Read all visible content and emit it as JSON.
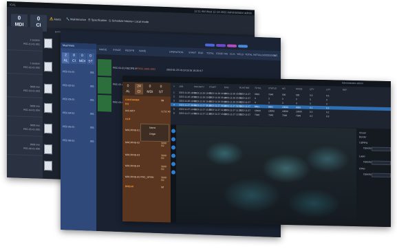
{
  "w1": {
    "title": "ICA1",
    "titlebar_right": "12:11 AM  Wed 12-14-2022   Administrator   admin",
    "tiles": [
      {
        "number": "0",
        "label": "MDI"
      },
      {
        "number": "0",
        "label": "CI"
      }
    ],
    "toolbar": [
      {
        "icon": "warning-icon",
        "label": "Alerts"
      },
      {
        "icon": "wrench-icon",
        "label": "Maintenance"
      },
      {
        "icon": "list-icon",
        "label": "Specification"
      },
      {
        "icon": "clock-icon",
        "label": "Schedule history"
      },
      {
        "icon": "add-user-icon",
        "label": "Local mode"
      }
    ],
    "sidebar": [
      {
        "a": "1 session",
        "b": "PEC-01-01 001"
      },
      {
        "a": "1 session",
        "b": "PEC-02-01 002"
      },
      {
        "a": "3000 min",
        "b": "PEC-03-01 003"
      },
      {
        "a": "3000 min",
        "b": "PEC-04-01 004"
      },
      {
        "a": "3000 min",
        "b": "PEC-05-01 005"
      },
      {
        "a": "3000 min",
        "b": "PEC-06-01 006"
      }
    ],
    "header_cols": [
      "BATCH",
      "BASEBATCH",
      "STATUS"
    ]
  },
  "w2": {
    "panel_title": "Machines",
    "minis": [
      {
        "n": "2",
        "l": "AL"
      },
      {
        "n": "8",
        "l": "CI"
      },
      {
        "n": "0",
        "l": "MDI"
      },
      {
        "n": "0",
        "l": "ST"
      }
    ],
    "left_items": [
      {
        "k": "PEC-01-01",
        "v": "001"
      },
      {
        "k": "PEC-02-01",
        "v": "001"
      },
      {
        "k": "PEC-03-01",
        "v": "001"
      },
      {
        "k": "PEC-04-01",
        "v": "001"
      },
      {
        "k": "PEC-05-01",
        "v": "001"
      },
      {
        "k": "PEC-06-01",
        "v": "001"
      }
    ],
    "headers": [
      "IMAGE",
      "STAGE",
      "RECIPE",
      "NAME",
      "OPERATION",
      "START",
      "END",
      "TOTAL",
      "GOOD",
      "NG",
      "CL%",
      "YIELD",
      "TOTAL",
      "INITIAL",
      "GOOD",
      "GOOD",
      "NG",
      "NG"
    ],
    "rows": [
      {
        "stage": "PEC-01-01 RECIPE A",
        "name": "PROC-1000-1002",
        "op": "2023-01-23 16:18 19:16 19:20 6:7"
      },
      {
        "stage": "PEC-02-01 RECIPE A",
        "name": "",
        "op": ""
      },
      {
        "stage": "PEC-03-01",
        "name": "",
        "op": ""
      }
    ]
  },
  "w3": {
    "titlebar": "Administrator   admin",
    "tiles": [
      {
        "n": "0",
        "l": "AL"
      },
      {
        "n": "24",
        "l": "CI"
      },
      {
        "n": "0",
        "l": "MDI"
      },
      {
        "n": "0",
        "l": "ST"
      }
    ],
    "rows": [
      {
        "k": "CONTAINER",
        "v": "16",
        "orange": true
      },
      {
        "k": "EQ",
        "v": "",
        "orange": true
      },
      {
        "k": "INS-MST",
        "v": "12:52:40",
        "orange": false
      },
      {
        "k": "OLD",
        "v": "",
        "orange": true
      },
      {
        "k": "MACHINE-01",
        "v": "3000 FR",
        "orange": false
      },
      {
        "k": "MACHINE-02",
        "v": "3000 FR",
        "orange": false
      },
      {
        "k": "MACHINE-03",
        "v": "3000 FR",
        "orange": false
      },
      {
        "k": "MACHINE-04",
        "v": "3000 FR",
        "orange": false
      },
      {
        "k": "MACHINE-05 PRC_OPEN",
        "v": "3000 FR",
        "orange": false
      },
      {
        "k": "BREAK",
        "v": "12",
        "orange": true
      }
    ],
    "popup": [
      "Name",
      "Origin"
    ],
    "columns": [
      "#",
      "JOB",
      "PRIORITY",
      "START",
      "END",
      "RUNTIME",
      "TOTAL",
      "STATUS",
      "NG",
      "MODE",
      "QTY",
      "LOT",
      "REF"
    ],
    "table": [
      [
        "1",
        "2023-11-26 18:00",
        "2023-11-26 19:00",
        "2023-11-26 19:30",
        "2023-11-26 20:00",
        "2023-11-27",
        "9999",
        "7048",
        "500",
        "500",
        "0.3",
        "0.5"
      ],
      [
        "2",
        "2023-11-26 18:50",
        "2023-11-26 19:50",
        "2023-11-26 20:10",
        "2023-11-26 20:30",
        "2023-11-27",
        "9",
        "3",
        "3",
        "3",
        "3",
        "3"
      ],
      [
        "3",
        "2023-11-26 19:00",
        "2023-11-26 19:40",
        "2023-11-26 20:20",
        "2023-11-26 20:40",
        "2023-11-27",
        "9",
        "3",
        "3",
        "3",
        "3",
        "3"
      ],
      [
        "4",
        "2023-11-27 08:00",
        "2023-11-27 08:30",
        "2023-11-27 09:00",
        "2023-11-27 09:30",
        "2023-11-27",
        "8831",
        "8831",
        "10000",
        "9000",
        "0.1",
        "0.2"
      ],
      [
        "5",
        "2023-11-27 10:00",
        "2023-11-27 10:30",
        "2023-11-27 11:00",
        "2023-11-27 11:30",
        "2023-11-27",
        "10000",
        "10000",
        "10000",
        "10000",
        "0.2",
        "0.2"
      ],
      [
        "6",
        "2023-11-27 12:00",
        "2023-11-27 12:30",
        "2023-11-27 13:00",
        "2023-11-27 13:30",
        "2023-11-27",
        "7048",
        "7048",
        "7048",
        "7048",
        "0.2",
        "0.3"
      ]
    ],
    "props": [
      {
        "k": "Visual"
      },
      {
        "k": "Border"
      },
      {
        "k": "Lighting"
      },
      {
        "k": "Opacity"
      },
      {
        "k": "Layer"
      },
      {
        "k": "Opacity"
      },
      {
        "k": "Other"
      },
      {
        "k": "Opacity"
      }
    ]
  }
}
